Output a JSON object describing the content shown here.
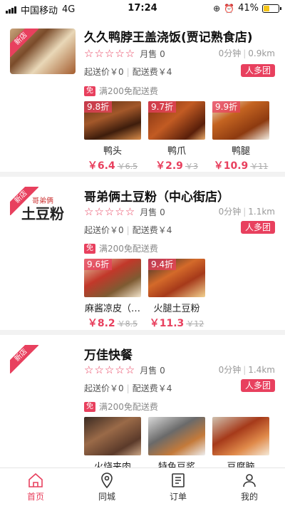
{
  "status_bar": {
    "carrier": "中国移动",
    "network": "4G",
    "time": "17:24",
    "battery": "41%"
  },
  "shops": [
    {
      "name": "久久鸭脖王盖浇饭(贾记熟食店)",
      "new_badge": "新店",
      "monthly_sales": "月售 0",
      "delivery_time": "0分钟",
      "distance": "0.9km",
      "min_order": "起送价￥0",
      "delivery_fee": "配送费￥4",
      "group_badge": "人多团",
      "promo_tag": "免",
      "promo_text": "满200免配送费",
      "dishes": [
        {
          "discount": "9.8折",
          "name": "鸭头",
          "price": "￥6.4",
          "original": "￥6.5"
        },
        {
          "discount": "9.7折",
          "name": "鸭爪",
          "price": "￥2.9",
          "original": "￥3"
        },
        {
          "discount": "9.9折",
          "name": "鸭腿",
          "price": "￥10.9",
          "original": "￥11"
        }
      ]
    },
    {
      "name": "哥弟俩土豆粉（中心街店）",
      "new_badge": "新店",
      "logo_text": "土豆粉",
      "logo_script": "哥弟俩",
      "monthly_sales": "月售 0",
      "delivery_time": "0分钟",
      "distance": "1.1km",
      "min_order": "起送价￥0",
      "delivery_fee": "配送费￥4",
      "group_badge": "人多团",
      "promo_tag": "免",
      "promo_text": "满200免配送费",
      "dishes": [
        {
          "discount": "9.6折",
          "name": "麻酱凉皮（…",
          "price": "￥8.2",
          "original": "￥8.5"
        },
        {
          "discount": "9.4折",
          "name": "火腿土豆粉",
          "price": "￥11.3",
          "original": "￥12"
        }
      ]
    },
    {
      "name": "万佳快餐",
      "new_badge": "新店",
      "monthly_sales": "月售 0",
      "delivery_time": "0分钟",
      "distance": "1.4km",
      "min_order": "起送价￥0",
      "delivery_fee": "配送费￥4",
      "group_badge": "人多团",
      "promo_tag": "免",
      "promo_text": "满200免配送费",
      "dishes": [
        {
          "name": "火烧夹肉"
        },
        {
          "name": "特色豆浆"
        },
        {
          "name": "豆腐脑"
        }
      ]
    }
  ],
  "tabbar": {
    "items": [
      {
        "label": "首页",
        "icon": "home-icon",
        "active": true
      },
      {
        "label": "同城",
        "icon": "location-pin-icon",
        "active": false
      },
      {
        "label": "订单",
        "icon": "order-list-icon",
        "active": false
      },
      {
        "label": "我的",
        "icon": "user-icon",
        "active": false
      }
    ],
    "accent_color": "#e8405e"
  }
}
